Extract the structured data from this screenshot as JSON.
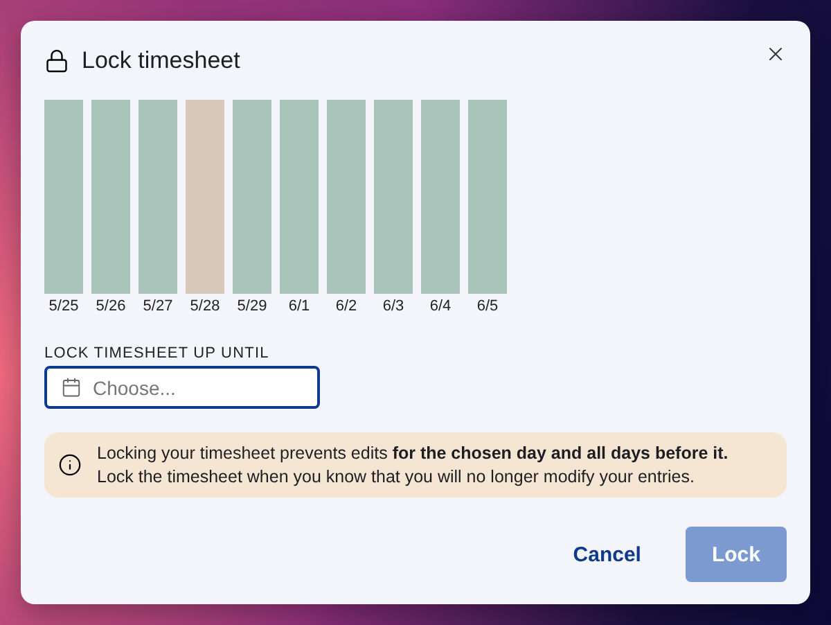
{
  "dialog": {
    "title": "Lock timesheet"
  },
  "days": [
    {
      "label": "5/25",
      "color": "#a8c4ba"
    },
    {
      "label": "5/26",
      "color": "#a8c4ba"
    },
    {
      "label": "5/27",
      "color": "#a8c4ba"
    },
    {
      "label": "5/28",
      "color": "#d5c8b8"
    },
    {
      "label": "5/29",
      "color": "#a8c4ba"
    },
    {
      "label": "6/1",
      "color": "#a8c4ba"
    },
    {
      "label": "6/2",
      "color": "#a8c4ba"
    },
    {
      "label": "6/3",
      "color": "#a8c4ba"
    },
    {
      "label": "6/4",
      "color": "#a8c4ba"
    },
    {
      "label": "6/5",
      "color": "#a8c4ba"
    }
  ],
  "date_field": {
    "label": "LOCK TIMESHEET UP UNTIL",
    "placeholder": "Choose..."
  },
  "notice": [
    "Locking your timesheet prevents edits **for the chosen day and all days before it.**",
    "Lock the timesheet when you know that you will no longer modify your entries."
  ],
  "buttons": [
    {
      "kind": "link",
      "label": "Cancel",
      "disabled": false
    },
    {
      "kind": "primary",
      "label": "Lock",
      "disabled": true
    }
  ]
}
